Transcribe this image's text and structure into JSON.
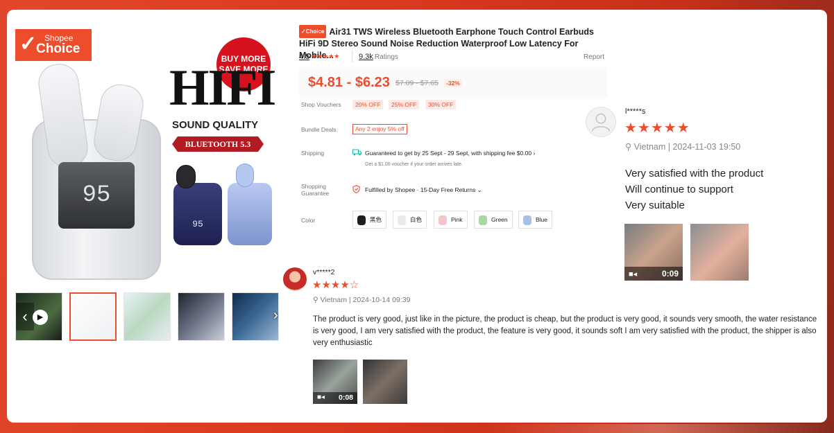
{
  "product_image": {
    "badge_small": "Shopee",
    "badge_big": "Choice",
    "promo_line1": "BUY MORE",
    "promo_line2": "SAVE MORE",
    "hifi": "HIFI",
    "sound_quality": "SOUND QUALITY",
    "bluetooth": "BLUETOOTH 5.3",
    "case_display": "95",
    "mini_display": "95"
  },
  "product": {
    "choice_tag": "✓Choice",
    "title": "Air31 TWS Wireless Bluetooth Earphone Touch Control Earbuds HiFi 9D Stereo Sound Noise Reduction Waterproof Low Latency For Mobile...",
    "rating": "4.5",
    "stars": "★★★★★",
    "ratings_count": "9.3k",
    "ratings_label": "Ratings",
    "report": "Report",
    "price": "$4.81 - $6.23",
    "original_price": "$7.09 - $7.65",
    "discount": "-32%",
    "labels": {
      "vouchers": "Shop Vouchers",
      "bundle": "Bundle Deals",
      "shipping": "Shipping",
      "guarantee_1": "Shopping",
      "guarantee_2": "Guarantee",
      "color": "Color"
    },
    "vouchers": [
      "20% OFF",
      "25% OFF",
      "30% OFF"
    ],
    "bundle_deal": "Any 2 enjoy 5% off",
    "shipping_text": "Guaranteed to get by 25 Sept - 29 Sept, with shipping fee $0.00",
    "shipping_sub": "Get a $1.00 voucher if your order arrives late.",
    "guarantee_text": "Fulfilled by Shopee · 15-Day Free Returns",
    "colors": [
      {
        "label": "黑色",
        "swatch": "#1d1d1f"
      },
      {
        "label": "白色",
        "swatch": "#e9eaec"
      },
      {
        "label": "Pink",
        "swatch": "#f3c7c9"
      },
      {
        "label": "Green",
        "swatch": "#a9d8a0"
      },
      {
        "label": "Blue",
        "swatch": "#a9c1e6"
      }
    ]
  },
  "review1": {
    "user": "l*****s",
    "stars": "★★★★★",
    "meta": "Vietnam | 2024-11-03 19:50",
    "lines": [
      "Very satisfied with the product",
      "Will continue to support",
      "Very suitable"
    ],
    "video_duration": "0:09"
  },
  "review2": {
    "user": "v*****2",
    "stars": "★★★★☆",
    "meta": "Vietnam | 2024-10-14 09:39",
    "text": "The product is very good, just like in the picture, the product is cheap, but the product is very good, it sounds very smooth, the water resistance is very good, I am very satisfied with the product, the feature is very good, it sounds soft I am very satisfied with the product, the shipper is also very enthusiastic",
    "video_duration": "0:08"
  },
  "colors": {
    "accent": "#ee4d2d",
    "background": "#d9391f"
  }
}
